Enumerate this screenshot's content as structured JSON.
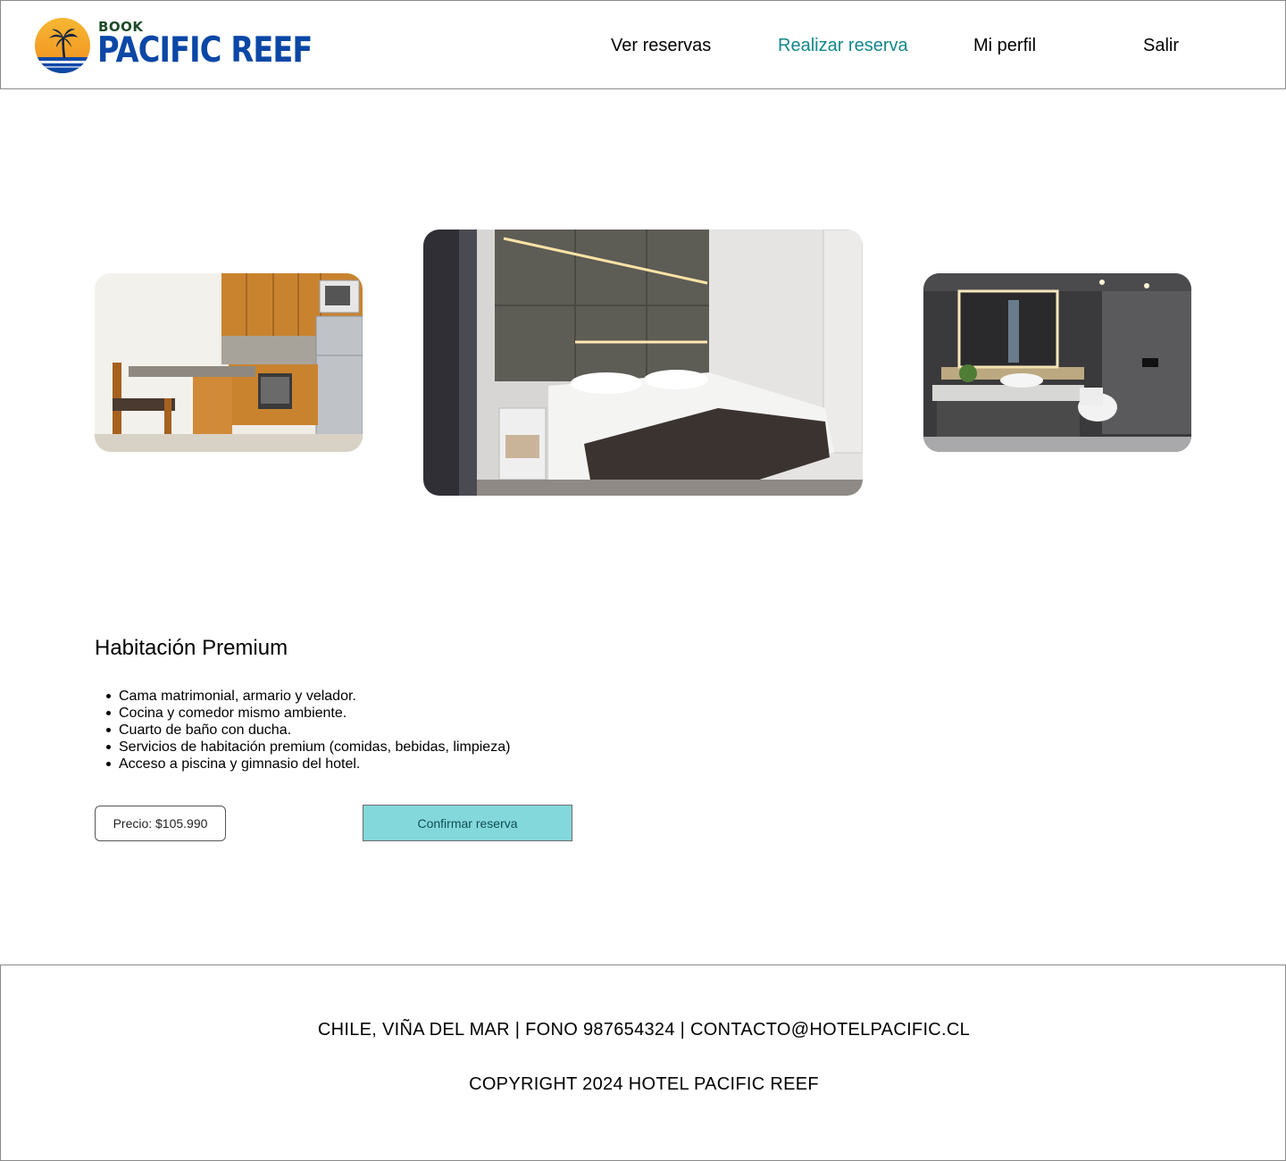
{
  "header": {
    "logo": {
      "small_text": "BOOK",
      "big_text": "PACIFIC REEF"
    },
    "nav": [
      {
        "label": "Ver reservas",
        "active": false
      },
      {
        "label": "Realizar reserva",
        "active": true
      },
      {
        "label": "Mi perfil",
        "active": false
      },
      {
        "label": "Salir",
        "active": false
      }
    ]
  },
  "gallery": {
    "images": [
      {
        "name": "kitchen-photo"
      },
      {
        "name": "bedroom-photo"
      },
      {
        "name": "bathroom-photo"
      }
    ]
  },
  "room": {
    "title": "Habitación Premium",
    "features": [
      "Cama matrimonial, armario y velador.",
      "Cocina y comedor mismo ambiente.",
      "Cuarto de baño con ducha.",
      "Servicios de habitación premium (comidas, bebidas, limpieza)",
      "Acceso a piscina y gimnasio del hotel."
    ],
    "price_label": "Precio: $105.990",
    "confirm_label": "Confirmar reserva"
  },
  "footer": {
    "contact": "CHILE, VIÑA DEL MAR | FONO 987654324 | CONTACTO@HOTELPACIFIC.CL",
    "copyright": "COPYRIGHT 2024 HOTEL PACIFIC REEF"
  },
  "colors": {
    "nav_active": "#13878a",
    "logo_blue": "#0b47a6",
    "logo_green": "#1e4c2a",
    "logo_sun": "#f4a623",
    "confirm_button": "#83d8dc"
  }
}
